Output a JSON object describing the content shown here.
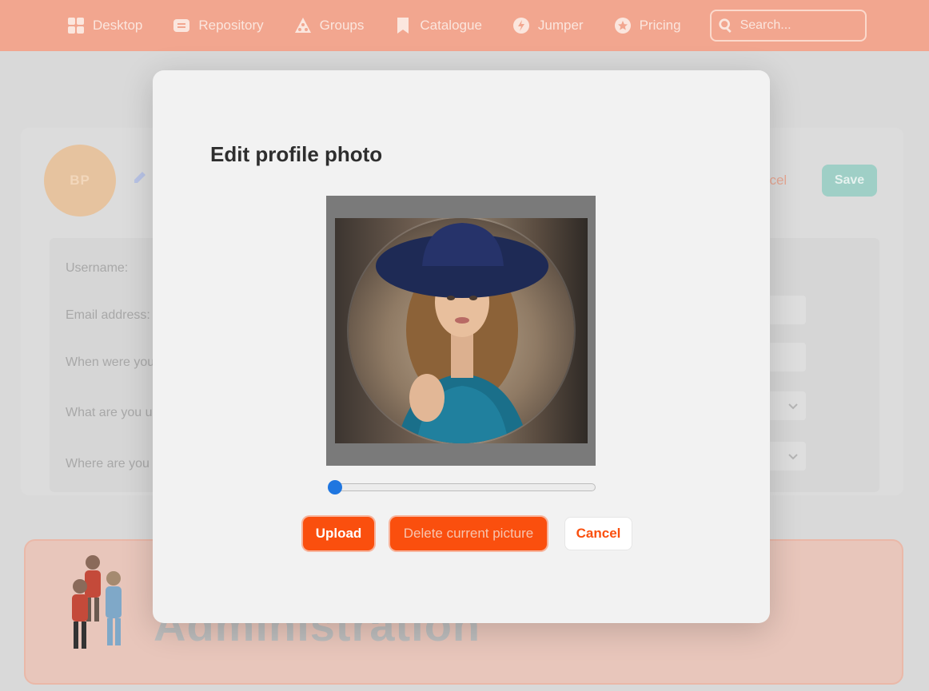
{
  "nav": {
    "items": [
      {
        "label": "Desktop",
        "icon": "grid-icon"
      },
      {
        "label": "Repository",
        "icon": "repository-icon"
      },
      {
        "label": "Groups",
        "icon": "groups-icon"
      },
      {
        "label": "Catalogue",
        "icon": "bookmark-icon"
      },
      {
        "label": "Jumper",
        "icon": "jumper-icon"
      },
      {
        "label": "Pricing",
        "icon": "star-icon"
      }
    ],
    "search_placeholder": "Search..."
  },
  "background": {
    "avatar_initials": "BP",
    "cancel_label": "ncel",
    "save_label": "Save",
    "form_labels": [
      "Username:",
      "Email address:",
      "When were you",
      "What are you u",
      "Where are you l"
    ],
    "admin_title": "Administration"
  },
  "modal": {
    "title": "Edit profile photo",
    "zoom_level": 0,
    "buttons": {
      "upload": "Upload",
      "delete": "Delete current picture",
      "cancel": "Cancel"
    }
  },
  "colors": {
    "nav_bg": "#f2a68f",
    "accent": "#fa4f0e",
    "slider_knob": "#1f76e0",
    "save_button": "#9fcfc6"
  }
}
